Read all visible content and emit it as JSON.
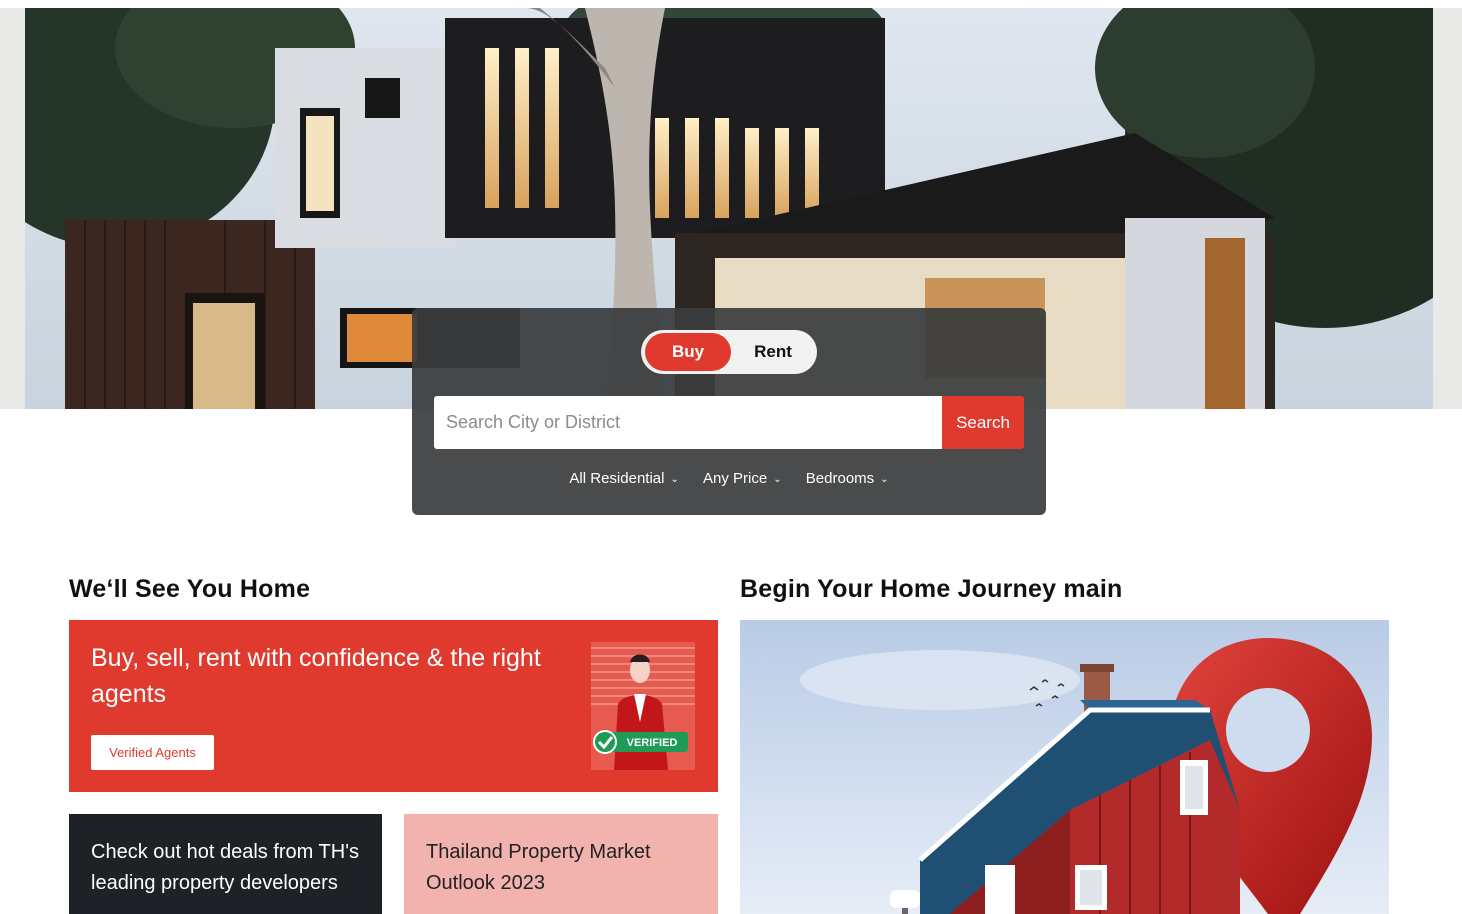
{
  "hero": {
    "image_desc": "modern-house-photo"
  },
  "search": {
    "toggle": {
      "buy_label": "Buy",
      "rent_label": "Rent",
      "selected": "Buy"
    },
    "placeholder": "Search City or District",
    "button_label": "Search",
    "filters": [
      {
        "label": "All Residential"
      },
      {
        "label": "Any Price"
      },
      {
        "label": "Bedrooms"
      }
    ]
  },
  "sections": {
    "left_title": "We‘ll See You Home",
    "right_title": "Begin Your Home Journey main"
  },
  "agents_card": {
    "headline": "Buy, sell, rent with confidence & the right agents",
    "button_label": "Verified Agents",
    "badge_label": "VERIFIED"
  },
  "deals_card": {
    "text": "Check out hot deals from TH's leading property developers"
  },
  "outlook_card": {
    "text": "Thailand Property Market Outlook 2023"
  },
  "colors": {
    "accent_red": "#e03a2f",
    "dark_card": "#1e2125",
    "pink_card": "#f2b2ae",
    "panel": "#3a3c3e"
  }
}
